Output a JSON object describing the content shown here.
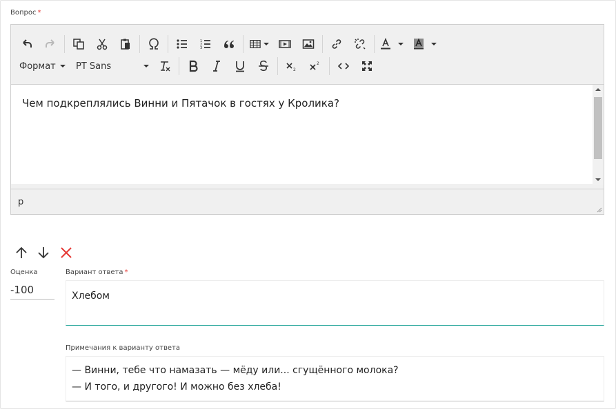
{
  "question": {
    "label": "Вопрос",
    "required_mark": "*",
    "editor": {
      "format_label": "Формат",
      "font_label": "PT Sans",
      "content": "Чем подкреплялись Винни и Пятачок в гостях у Кролика?",
      "status_path": "p"
    }
  },
  "answer": {
    "score_label": "Оценка",
    "score_value": "-100",
    "option_label": "Вариант ответа",
    "required_mark": "*",
    "option_value": "Хлебом",
    "notes_label": "Примечания к варианту ответа",
    "notes_lines": [
      "— Винни, тебе что намазать — мёду или... сгущённого молока?",
      "— И того, и другого! И можно без хлеба!"
    ]
  },
  "colors": {
    "required": "#e53935",
    "delete": "#e53935",
    "focus_underline": "#26a69a"
  },
  "icons": {
    "toolbar_row1": [
      "undo-icon",
      "redo-icon",
      "copy-icon",
      "cut-icon",
      "paste-icon",
      "special-char-icon",
      "bullet-list-icon",
      "numbered-list-icon",
      "blockquote-icon",
      "table-icon",
      "media-icon",
      "image-icon",
      "link-icon",
      "unlink-icon",
      "text-color-icon",
      "background-color-icon"
    ],
    "toolbar_row2": [
      "clear-format-icon",
      "bold-icon",
      "italic-icon",
      "underline-icon",
      "strikethrough-icon",
      "subscript-icon",
      "superscript-icon",
      "source-code-icon",
      "fullscreen-icon"
    ],
    "answer_controls": [
      "arrow-up-icon",
      "arrow-down-icon",
      "close-icon"
    ]
  }
}
